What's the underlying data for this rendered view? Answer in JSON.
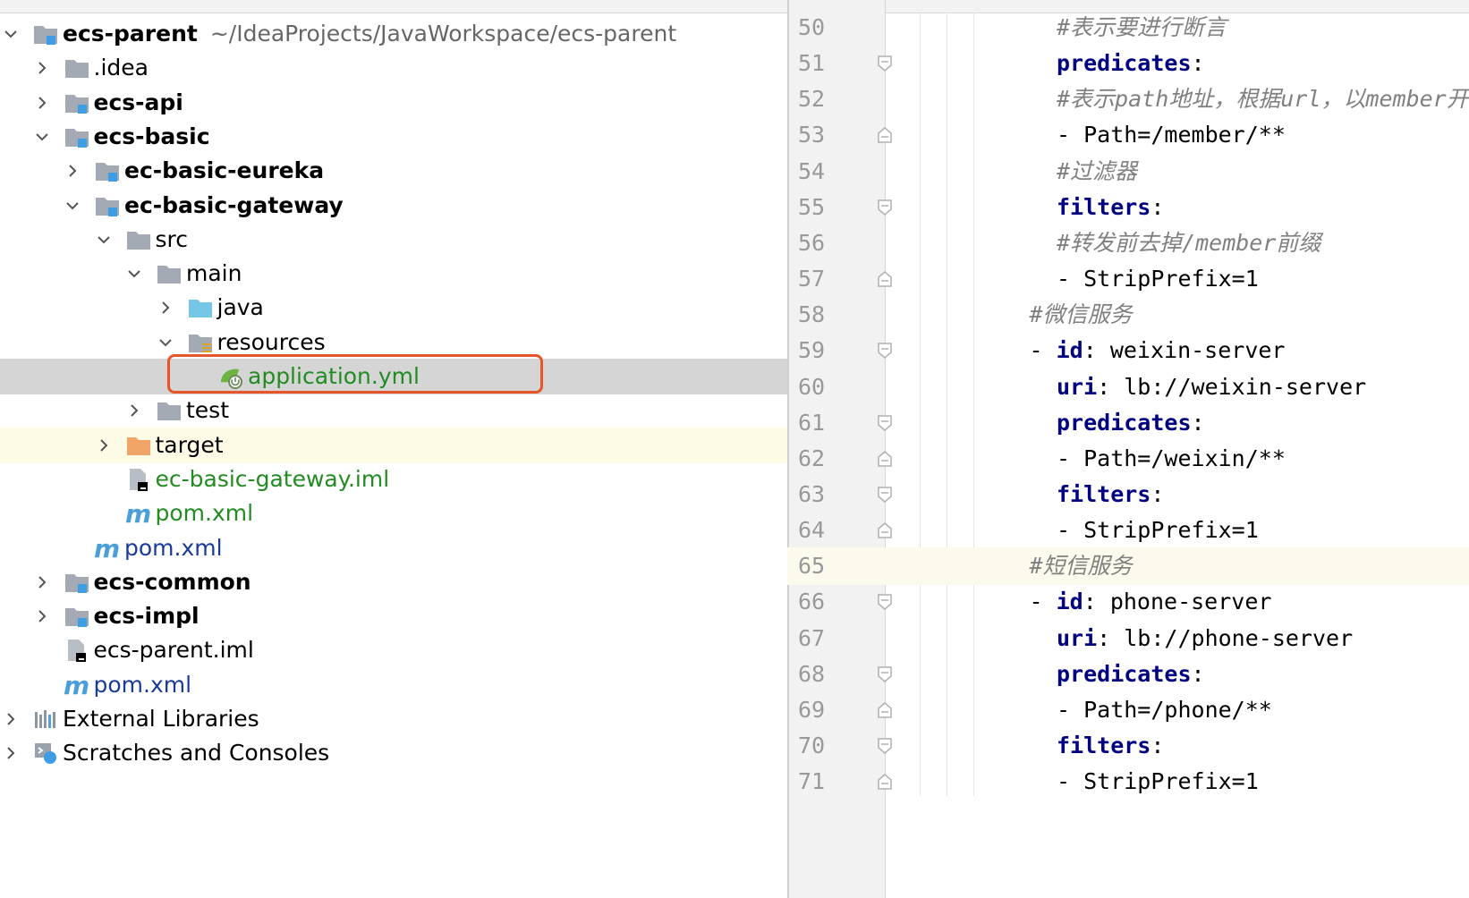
{
  "colors": {
    "folder_gray": "#a3aab3",
    "module_blue": "#3d9ee6",
    "package_blue": "#76c6e8",
    "excluded_orange": "#f0a466",
    "modified_green": "#228b22",
    "maven_blue": "#1a3a9c",
    "yaml_key": "#000080",
    "comment": "#808080",
    "highlight_box": "#e8542c"
  },
  "tree": {
    "items": [
      {
        "label": "ecs-parent",
        "path": "~/IdeaProjects/JavaWorkspace/ecs-parent",
        "chevron": "down",
        "icon": "module-folder-icon",
        "style": "bold"
      },
      {
        "label": ".idea",
        "chevron": "right",
        "icon": "folder-icon",
        "style": "normal"
      },
      {
        "label": "ecs-api",
        "chevron": "right",
        "icon": "module-folder-icon",
        "style": "bold"
      },
      {
        "label": "ecs-basic",
        "chevron": "down",
        "icon": "module-folder-icon",
        "style": "bold"
      },
      {
        "label": "ec-basic-eureka",
        "chevron": "right",
        "icon": "module-folder-icon",
        "style": "bold"
      },
      {
        "label": "ec-basic-gateway",
        "chevron": "down",
        "icon": "module-folder-icon",
        "style": "bold"
      },
      {
        "label": "src",
        "chevron": "down",
        "icon": "folder-icon",
        "style": "normal"
      },
      {
        "label": "main",
        "chevron": "down",
        "icon": "folder-icon",
        "style": "normal"
      },
      {
        "label": "java",
        "chevron": "right",
        "icon": "source-folder-icon",
        "style": "normal"
      },
      {
        "label": "resources",
        "chevron": "down",
        "icon": "resources-folder-icon",
        "style": "normal"
      },
      {
        "label": "application.yml",
        "chevron": "none",
        "icon": "spring-yaml-icon",
        "style": "green",
        "selected": true
      },
      {
        "label": "test",
        "chevron": "right",
        "icon": "folder-icon",
        "style": "normal"
      },
      {
        "label": "target",
        "chevron": "right",
        "icon": "excluded-folder-icon",
        "style": "normal"
      },
      {
        "label": "ec-basic-gateway.iml",
        "chevron": "none",
        "icon": "iml-file-icon",
        "style": "green"
      },
      {
        "label": "pom.xml",
        "chevron": "none",
        "icon": "maven-icon",
        "style": "green"
      },
      {
        "label": "pom.xml",
        "chevron": "none",
        "icon": "maven-icon",
        "style": "blue"
      },
      {
        "label": "ecs-common",
        "chevron": "right",
        "icon": "module-folder-icon",
        "style": "bold"
      },
      {
        "label": "ecs-impl",
        "chevron": "right",
        "icon": "module-folder-icon",
        "style": "bold"
      },
      {
        "label": "ecs-parent.iml",
        "chevron": "none",
        "icon": "iml-file-icon",
        "style": "normal"
      },
      {
        "label": "pom.xml",
        "chevron": "none",
        "icon": "maven-icon",
        "style": "blue"
      },
      {
        "label": "External Libraries",
        "chevron": "right",
        "icon": "library-icon",
        "style": "normal"
      },
      {
        "label": "Scratches and Consoles",
        "chevron": "right",
        "icon": "scratches-icon",
        "style": "normal"
      }
    ]
  },
  "editor": {
    "caret_line": "65",
    "lines": [
      {
        "num": "50",
        "fold": "none",
        "tokens": [
          {
            "t": "#表示要进行断言",
            "k": "comment"
          }
        ]
      },
      {
        "num": "51",
        "fold": "start",
        "tokens": [
          {
            "t": "predicates",
            "k": "key"
          },
          {
            "t": ":",
            "k": "plain"
          }
        ]
      },
      {
        "num": "52",
        "fold": "none",
        "tokens": [
          {
            "t": "#表示path地址，根据url，以member开头",
            "k": "comment"
          }
        ]
      },
      {
        "num": "53",
        "fold": "end",
        "tokens": [
          {
            "t": "- Path=/member/**",
            "k": "plain"
          }
        ]
      },
      {
        "num": "54",
        "fold": "none",
        "tokens": [
          {
            "t": "#过滤器",
            "k": "comment"
          }
        ]
      },
      {
        "num": "55",
        "fold": "start",
        "tokens": [
          {
            "t": "filters",
            "k": "key"
          },
          {
            "t": ":",
            "k": "plain"
          }
        ]
      },
      {
        "num": "56",
        "fold": "none",
        "tokens": [
          {
            "t": "#转发前去掉/member前缀",
            "k": "comment"
          }
        ]
      },
      {
        "num": "57",
        "fold": "end",
        "tokens": [
          {
            "t": "- StripPrefix=1",
            "k": "plain"
          }
        ]
      },
      {
        "num": "58",
        "fold": "none",
        "tokens": [
          {
            "t": "#微信服务",
            "k": "comment"
          }
        ]
      },
      {
        "num": "59",
        "fold": "start",
        "tokens": [
          {
            "t": "- ",
            "k": "plain"
          },
          {
            "t": "id",
            "k": "key"
          },
          {
            "t": ": weixin-server",
            "k": "plain"
          }
        ]
      },
      {
        "num": "60",
        "fold": "none",
        "tokens": [
          {
            "t": "uri",
            "k": "key"
          },
          {
            "t": ": lb://weixin-server",
            "k": "plain"
          }
        ]
      },
      {
        "num": "61",
        "fold": "start",
        "tokens": [
          {
            "t": "predicates",
            "k": "key"
          },
          {
            "t": ":",
            "k": "plain"
          }
        ]
      },
      {
        "num": "62",
        "fold": "end",
        "tokens": [
          {
            "t": "- Path=/weixin/**",
            "k": "plain"
          }
        ]
      },
      {
        "num": "63",
        "fold": "start",
        "tokens": [
          {
            "t": "filters",
            "k": "key"
          },
          {
            "t": ":",
            "k": "plain"
          }
        ]
      },
      {
        "num": "64",
        "fold": "end",
        "tokens": [
          {
            "t": "- StripPrefix=1",
            "k": "plain"
          }
        ]
      },
      {
        "num": "65",
        "fold": "none",
        "tokens": [
          {
            "t": "#短信服务",
            "k": "comment"
          }
        ]
      },
      {
        "num": "66",
        "fold": "start",
        "tokens": [
          {
            "t": "- ",
            "k": "plain"
          },
          {
            "t": "id",
            "k": "key"
          },
          {
            "t": ": phone-server",
            "k": "plain"
          }
        ]
      },
      {
        "num": "67",
        "fold": "none",
        "tokens": [
          {
            "t": "uri",
            "k": "key"
          },
          {
            "t": ": lb://phone-server",
            "k": "plain"
          }
        ]
      },
      {
        "num": "68",
        "fold": "start",
        "tokens": [
          {
            "t": "predicates",
            "k": "key"
          },
          {
            "t": ":",
            "k": "plain"
          }
        ]
      },
      {
        "num": "69",
        "fold": "end",
        "tokens": [
          {
            "t": "- Path=/phone/**",
            "k": "plain"
          }
        ]
      },
      {
        "num": "70",
        "fold": "start",
        "tokens": [
          {
            "t": "filters",
            "k": "key"
          },
          {
            "t": ":",
            "k": "plain"
          }
        ]
      },
      {
        "num": "71",
        "fold": "end",
        "tokens": [
          {
            "t": "- StripPrefix=1",
            "k": "plain"
          }
        ]
      }
    ]
  }
}
